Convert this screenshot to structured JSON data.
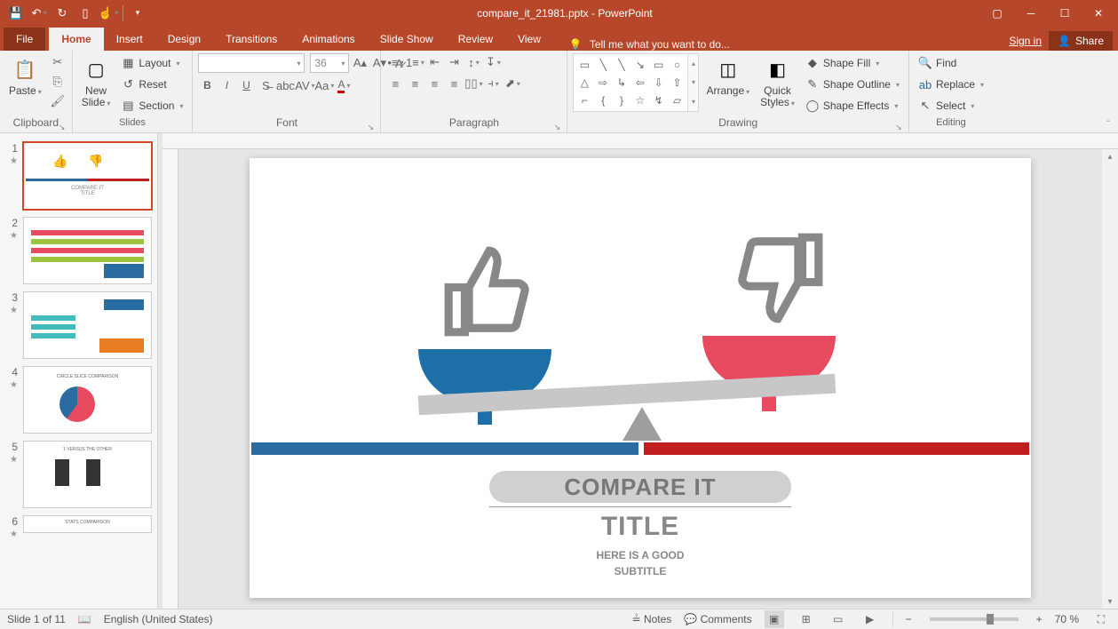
{
  "app": {
    "title": "compare_it_21981.pptx - PowerPoint"
  },
  "window": {
    "signin": "Sign in",
    "share": "Share"
  },
  "tabs": {
    "file": "File",
    "home": "Home",
    "insert": "Insert",
    "design": "Design",
    "transitions": "Transitions",
    "animations": "Animations",
    "slideshow": "Slide Show",
    "review": "Review",
    "view": "View",
    "tellme": "Tell me what you want to do..."
  },
  "ribbon": {
    "clipboard": {
      "paste": "Paste",
      "label": "Clipboard"
    },
    "slides": {
      "newslide": "New\nSlide",
      "layout": "Layout",
      "reset": "Reset",
      "section": "Section",
      "label": "Slides"
    },
    "font": {
      "size": "36",
      "label": "Font"
    },
    "paragraph": {
      "label": "Paragraph"
    },
    "drawing": {
      "arrange": "Arrange",
      "quick": "Quick\nStyles",
      "fill": "Shape Fill",
      "outline": "Shape Outline",
      "effects": "Shape Effects",
      "label": "Drawing"
    },
    "editing": {
      "find": "Find",
      "replace": "Replace",
      "select": "Select",
      "label": "Editing"
    }
  },
  "thumbnails": [
    {
      "n": "1",
      "active": true
    },
    {
      "n": "2"
    },
    {
      "n": "3"
    },
    {
      "n": "4"
    },
    {
      "n": "5"
    },
    {
      "n": "6"
    }
  ],
  "slide": {
    "pill": "COMPARE IT",
    "title": "TITLE",
    "sub1": "HERE IS A GOOD",
    "sub2": "SUBTITLE"
  },
  "status": {
    "page": "Slide 1 of 11",
    "lang": "English (United States)",
    "notes": "Notes",
    "comments": "Comments",
    "zoom": "70 %"
  }
}
